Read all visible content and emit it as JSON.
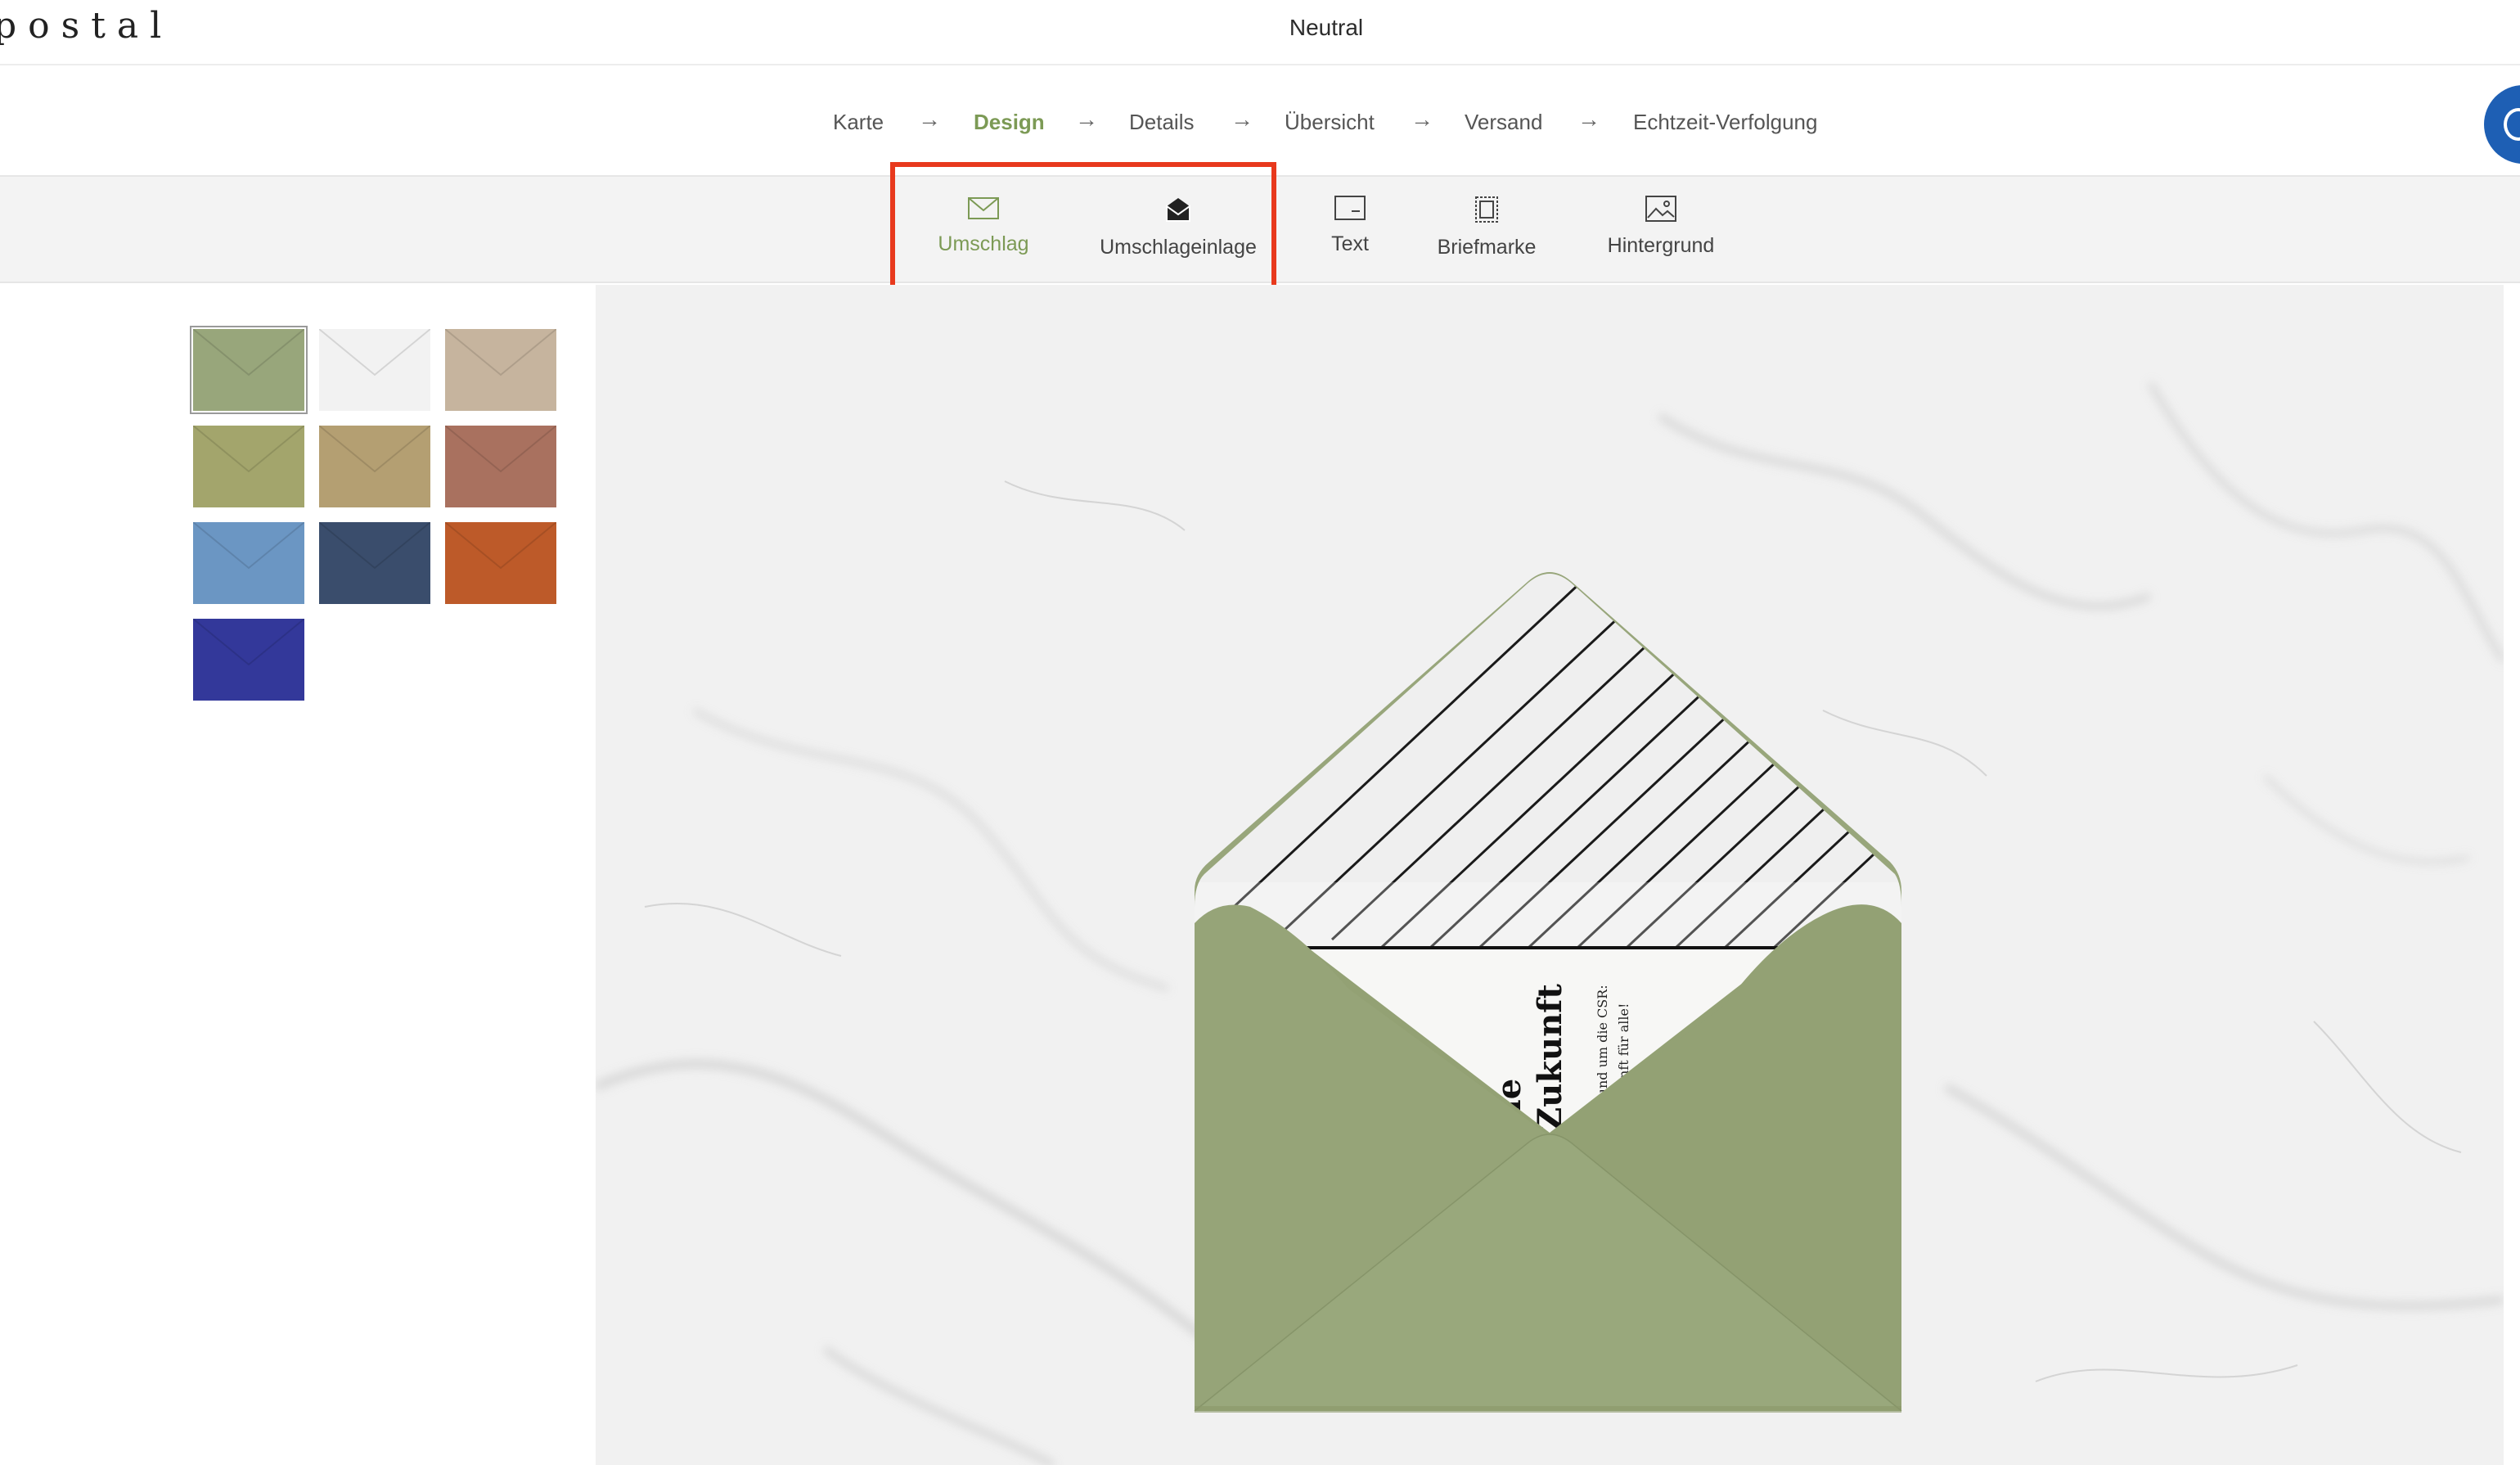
{
  "header": {
    "logo": "postal",
    "title": "Neutral"
  },
  "steps": [
    {
      "label": "Karte"
    },
    {
      "label": "Design"
    },
    {
      "label": "Details"
    },
    {
      "label": "Übersicht"
    },
    {
      "label": "Versand"
    },
    {
      "label": "Echtzeit-Verfolgung"
    }
  ],
  "active_step": "Design",
  "toolbar": {
    "tools": [
      {
        "label": "Umschlag",
        "icon": "envelope-icon"
      },
      {
        "label": "Umschlageinlage",
        "icon": "envelope-liner-icon"
      },
      {
        "label": "Text",
        "icon": "text-card-icon"
      },
      {
        "label": "Briefmarke",
        "icon": "stamp-icon"
      },
      {
        "label": "Hintergrund",
        "icon": "image-icon"
      }
    ],
    "active_tool": "Umschlag"
  },
  "colors": {
    "accent": "#7c9a55",
    "highlight": "#e8391d",
    "avatar": "#1e5fb4"
  },
  "swatches": [
    {
      "color": "#98a67b",
      "name": "sage",
      "selected": true
    },
    {
      "color": "#f2f2f2",
      "name": "white",
      "selected": false
    },
    {
      "color": "#c6b49e",
      "name": "kraft",
      "selected": false
    },
    {
      "color": "#a3a56c",
      "name": "olive",
      "selected": false
    },
    {
      "color": "#b49f72",
      "name": "gold-glitter",
      "selected": false
    },
    {
      "color": "#a9715f",
      "name": "copper-glitter",
      "selected": false
    },
    {
      "color": "#6b96c3",
      "name": "light-blue",
      "selected": false
    },
    {
      "color": "#3a4d6c",
      "name": "navy",
      "selected": false
    },
    {
      "color": "#bd5a29",
      "name": "rust",
      "selected": false
    },
    {
      "color": "#33389a",
      "name": "royal-blue",
      "selected": false
    }
  ],
  "preview": {
    "envelope_color": "#98a67b",
    "card_text_large_1": "r eine",
    "card_text_large_2": "Zukunft",
    "card_text_small_1": "rund um die CSR:",
    "card_text_small_2": "kunft für alle!"
  }
}
